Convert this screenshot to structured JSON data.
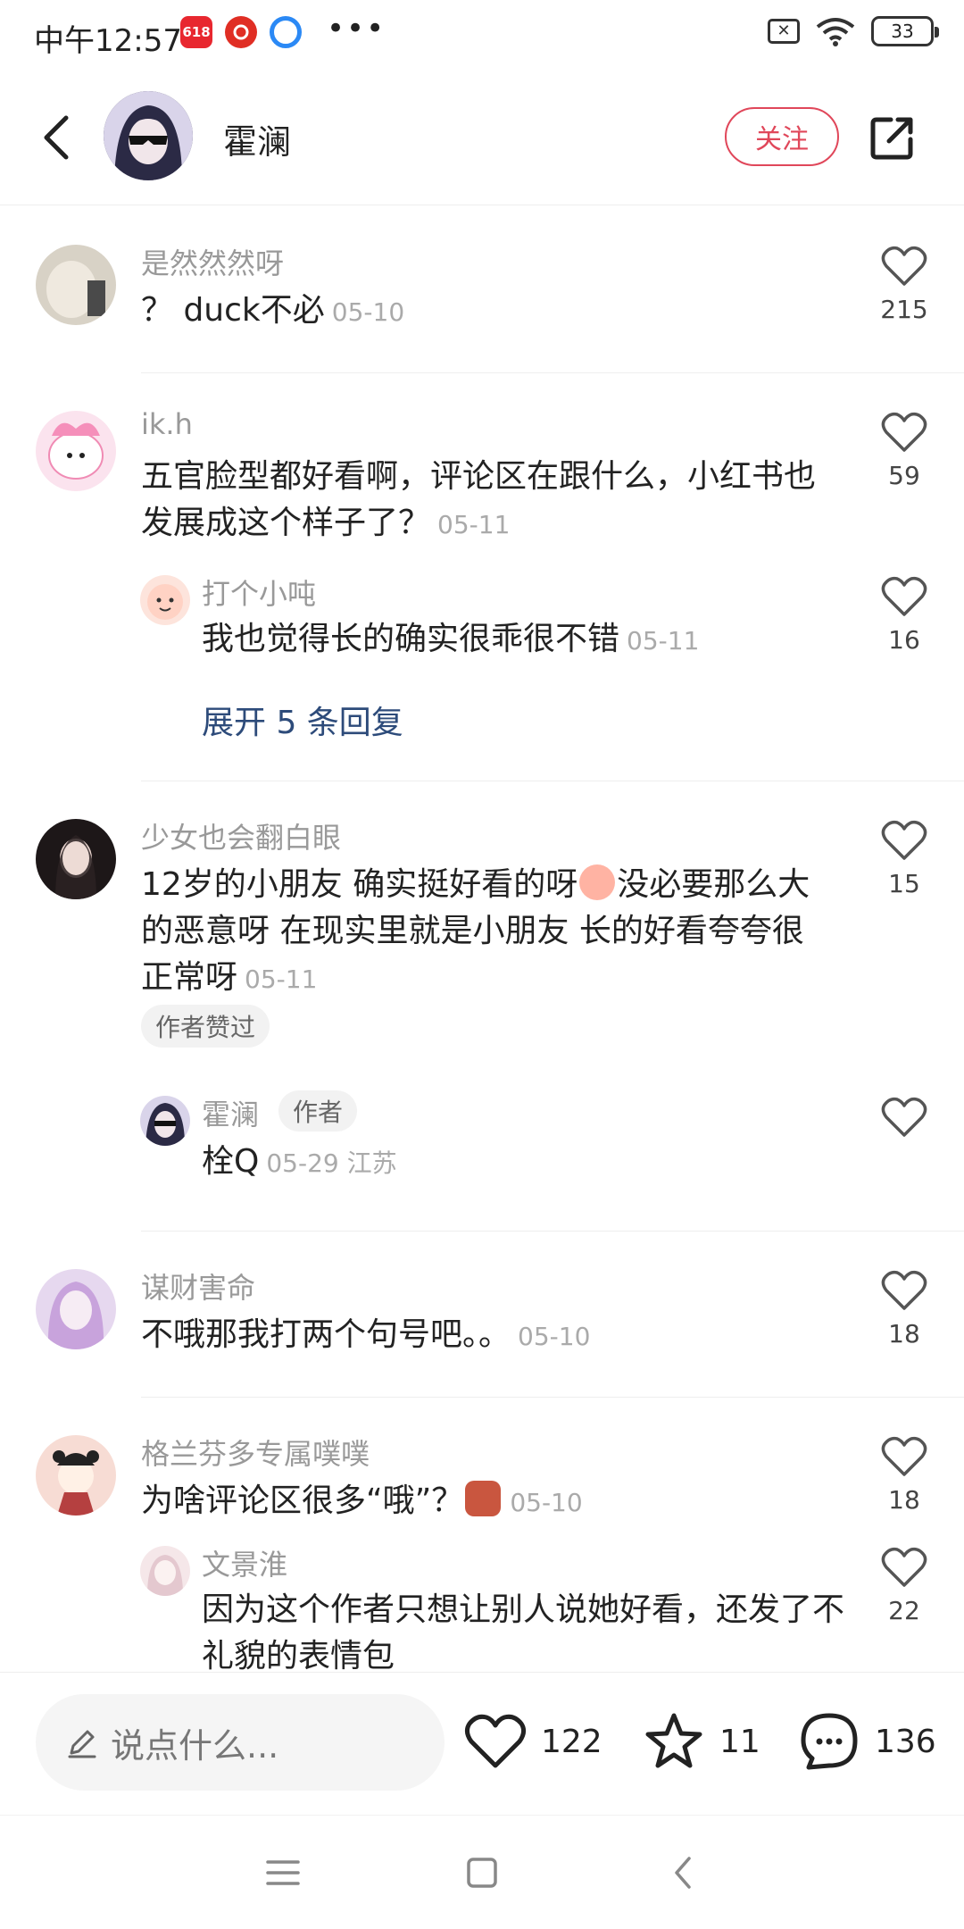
{
  "status_bar": {
    "time": "中午12:57",
    "app1": "618",
    "battery": "33"
  },
  "header": {
    "author_name": "霍澜",
    "follow_label": "关注"
  },
  "comments": [
    {
      "user": "是然然然呀",
      "text": "？ duck不必",
      "date": "05-10",
      "likes": "215"
    },
    {
      "user": "ik.h",
      "text": "五官脸型都好看啊，评论区在跟什么，小红书也发展成这个样子了？",
      "date": "05-11",
      "likes": "59",
      "reply": {
        "user": "打个小吨",
        "text": "我也觉得长的确实很乖很不错",
        "date": "05-11",
        "likes": "16"
      },
      "expand": "展开 5 条回复"
    },
    {
      "user": "少女也会翻白眼",
      "text_a": "12岁的小朋友 确实挺好看的呀",
      "text_b": "没必要那么大的恶意呀 在现实里就是小朋友 长的好看夸夸很正常呀",
      "date": "05-11",
      "likes": "15",
      "chip": "作者赞过",
      "reply": {
        "user": "霍澜",
        "badge": "作者",
        "text": "栓Q",
        "date": "05-29 江苏"
      }
    },
    {
      "user": "谋财害命",
      "text": "不哦那我打两个句号吧。。",
      "date": "05-10",
      "likes": "18"
    },
    {
      "user": "格兰芬多专属噗噗",
      "text": "为啥评论区很多“哦”？",
      "date": "05-10",
      "likes": "18",
      "reply": {
        "user": "文景淮",
        "text": "因为这个作者只想让别人说她好看，还发了不礼貌的表情包",
        "likes": "22"
      }
    }
  ],
  "bottom_bar": {
    "input_placeholder": "说点什么...",
    "likes": "122",
    "stars": "11",
    "comments": "136"
  }
}
